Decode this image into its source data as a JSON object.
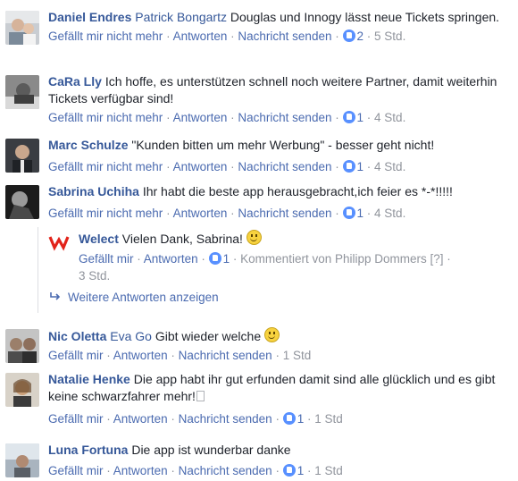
{
  "actions": {
    "like": "Gefällt mir nicht mehr",
    "like_short": "Gefällt mir",
    "reply": "Antworten",
    "message": "Nachricht senden",
    "sep": "·"
  },
  "comments": [
    {
      "name": "Daniel Endres",
      "tag": "Patrick Bongartz",
      "text": "Douglas und Innogy lässt neue Tickets springen.",
      "likes": "2",
      "time": "5 Std."
    },
    {
      "name": "CaRa Lly",
      "text": "Ich hoffe, es unterstützen schnell noch weitere Partner, damit weiterhin Tickets verfügbar sind!",
      "likes": "1",
      "time": "4 Std."
    },
    {
      "name": "Marc Schulze",
      "text": "\"Kunden bitten um mehr Werbung\" - besser geht nicht!",
      "likes": "1",
      "time": "4 Std."
    },
    {
      "name": "Sabrina Uchiha",
      "text": "Ihr habt die beste app herausgebracht,ich feier es *-*!!!!!",
      "likes": "1",
      "time": "4 Std."
    },
    {
      "name": "Nic Oletta",
      "tag": "Eva Go",
      "text": "Gibt wieder welche",
      "time": "1 Std"
    },
    {
      "name": "Natalie Henke",
      "text": "Die app habt ihr gut erfunden damit sind alle glücklich und es gibt keine schwarzfahrer mehr!",
      "likes": "1",
      "time": "1 Std"
    },
    {
      "name": "Luna Fortuna",
      "text": "Die app ist wunderbar danke",
      "likes": "1",
      "time": "1 Std"
    }
  ],
  "reply": {
    "name": "Welect",
    "text": "Vielen Dank, Sabrina!",
    "likes": "1",
    "commented_by": "Kommentiert von Philipp Dommers",
    "help": "[?]",
    "time": "3 Std."
  },
  "more_replies": "Weitere Antworten anzeigen",
  "colors": {
    "link": "#365899",
    "muted": "#90949c",
    "like_blue": "#5890ff",
    "brand": "#e2231a"
  },
  "icons": [
    "like-icon",
    "reply-arrow-icon",
    "smiley-icon",
    "welect-logo-icon"
  ]
}
